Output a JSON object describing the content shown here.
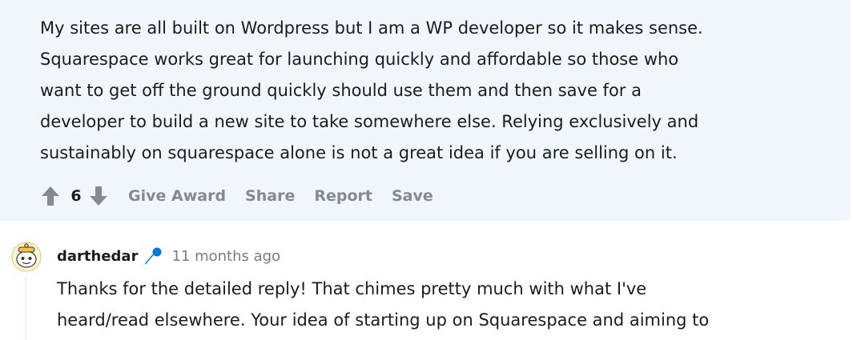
{
  "top_comment": {
    "body_lines": [
      "My sites are all built on Wordpress but I am a WP developer so it makes sense.",
      "Squarespace works great for launching quickly and affordable so those who",
      "want to get off the ground quickly should use them and then save for a",
      "developer to build a new site to take somewhere else. Relying exclusively and",
      "sustainably on squarespace alone is not a great idea if you are selling on it."
    ],
    "vote_count": "6",
    "actions": {
      "give_award": "Give Award",
      "share": "Share",
      "report": "Report",
      "save": "Save"
    },
    "icons": {
      "upvote": "upvote-arrow-icon",
      "downvote": "downvote-arrow-icon"
    },
    "colors": {
      "background": "#f1f5fc",
      "text": "#1c1c1c",
      "action": "#878a8c",
      "vote_icon": "#878a8c"
    }
  },
  "reply": {
    "username": "darthedar",
    "timestamp": "11 months ago",
    "body_lines": [
      "Thanks for the detailed reply! That chimes pretty much with what I've",
      "heard/read elsewhere. Your idea of starting up on Squarespace and aiming to"
    ],
    "icons": {
      "avatar": "snoo-avatar-icon",
      "flair": "microphone-icon"
    },
    "colors": {
      "flair": "#0079d3",
      "timestamp": "#787c7e"
    }
  }
}
